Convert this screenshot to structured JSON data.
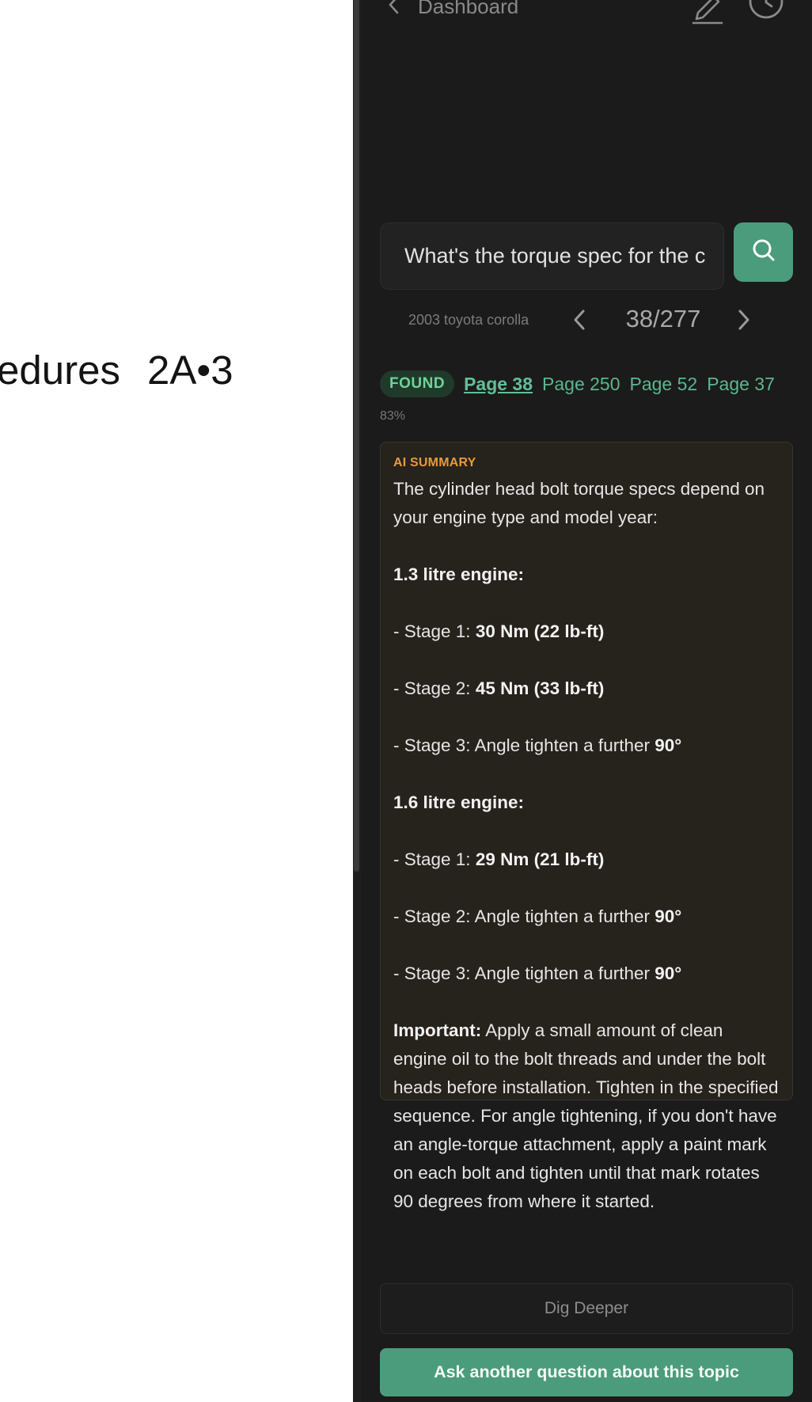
{
  "document": {
    "heading_text": "edures",
    "heading_code": "2A•3"
  },
  "header": {
    "back_label": "Dashboard",
    "edit_icon": "pencil-icon",
    "history_icon": "clock-icon"
  },
  "search": {
    "query": "What's the torque spec for the cylinder head bolts?",
    "button_icon": "search-icon"
  },
  "navigation": {
    "document_name": "2003 toyota corolla",
    "current_page": "38/277"
  },
  "results": {
    "found_label": "FOUND",
    "pages": [
      "Page 38",
      "Page 250",
      "Page 52",
      "Page 37"
    ],
    "confidence": "83%"
  },
  "summary": {
    "label": "AI SUMMARY",
    "intro": "The cylinder head bolt torque specs depend on your engine type and model year:",
    "engine1_title": "1.3 litre engine:",
    "e1_s1_prefix": "- Stage 1: ",
    "e1_s1_value": "30 Nm (22 lb-ft)",
    "e1_s2_prefix": "- Stage 2: ",
    "e1_s2_value": "45 Nm (33 lb-ft)",
    "e1_s3_prefix": "- Stage 3: Angle tighten a further ",
    "e1_s3_value": "90°",
    "engine2_title": "1.6 litre engine:",
    "e2_s1_prefix": "- Stage 1: ",
    "e2_s1_value": "29 Nm (21 lb-ft)",
    "e2_s2_prefix": "- Stage 2: Angle tighten a further ",
    "e2_s2_value": "90°",
    "e2_s3_prefix": "- Stage 3: Angle tighten a further ",
    "e2_s3_value": "90°",
    "important_label": "Important:",
    "important_text": " Apply a small amount of clean engine oil to the bolt threads and under the bolt heads before installation. Tighten in the specified sequence. For angle tightening, if you don't have an angle-torque attachment, apply a paint mark on each bolt and tighten until that mark rotates 90 degrees from where it started."
  },
  "actions": {
    "dig_deeper": "Dig Deeper",
    "ask_another": "Ask another question about this topic"
  },
  "colors": {
    "accent": "#4a9c7c",
    "panel_bg": "#1b1b1b",
    "summary_bg": "#26221c",
    "summary_label": "#e89a3c",
    "found_text": "#6fd39a"
  }
}
